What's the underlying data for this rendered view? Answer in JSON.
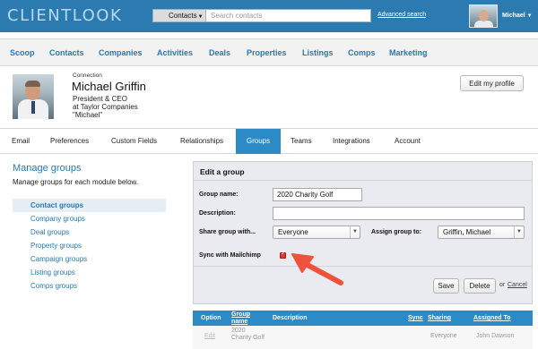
{
  "header": {
    "logo": "CLIENTLOOK",
    "search_scope": "Contacts",
    "search_placeholder": "Search contacts",
    "advanced_search": "Advanced search",
    "user_name": "Michael"
  },
  "main_nav": [
    "Scoop",
    "Contacts",
    "Companies",
    "Activities",
    "Deals",
    "Properties",
    "Listings",
    "Comps",
    "Marketing"
  ],
  "profile": {
    "label": "Connection",
    "name": "Michael Griffin",
    "title": "President & CEO",
    "company": "at Taylor Companies",
    "nickname": "\"Michael\"",
    "edit_button": "Edit my profile"
  },
  "sub_nav": {
    "tabs": [
      "Email",
      "Preferences",
      "Custom Fields",
      "Relationships",
      "Groups",
      "Teams",
      "Integrations",
      "Account"
    ],
    "active": "Groups"
  },
  "sidebar": {
    "title": "Manage groups",
    "subtitle": "Manage groups for each module below.",
    "items": [
      "Contact groups",
      "Company groups",
      "Deal groups",
      "Property groups",
      "Campaign groups",
      "Listing groups",
      "Comps groups"
    ],
    "active": "Contact groups"
  },
  "edit_group": {
    "title": "Edit a group",
    "group_name_label": "Group name:",
    "group_name_value": "2020 Charity Golf",
    "description_label": "Description:",
    "description_value": "",
    "share_label": "Share group with...",
    "share_value": "Everyone",
    "assign_label": "Assign group to:",
    "assign_value": "Griffin, Michael",
    "sync_label": "Sync with Mailchimp",
    "sync_checked": true,
    "save": "Save",
    "delete": "Delete",
    "or": "or",
    "cancel": "Cancel"
  },
  "table": {
    "headers": {
      "option": "Option",
      "group_name_1": "Group",
      "group_name_2": "name",
      "description": "Description",
      "sync": "Sync",
      "sharing": "Sharing",
      "assigned_to": "Assigned To"
    },
    "rows": [
      {
        "option": "Edit",
        "group_name_1": "2020",
        "group_name_2": "Charity Golf",
        "sharing": "Everyone",
        "assigned_to": "John Dawson"
      }
    ]
  },
  "colors": {
    "topbar": "#2b7bb0",
    "link": "#2679b5",
    "active_tab": "#2c8ac6",
    "arrow": "#f0513b",
    "panel": "#eaeaf1"
  }
}
